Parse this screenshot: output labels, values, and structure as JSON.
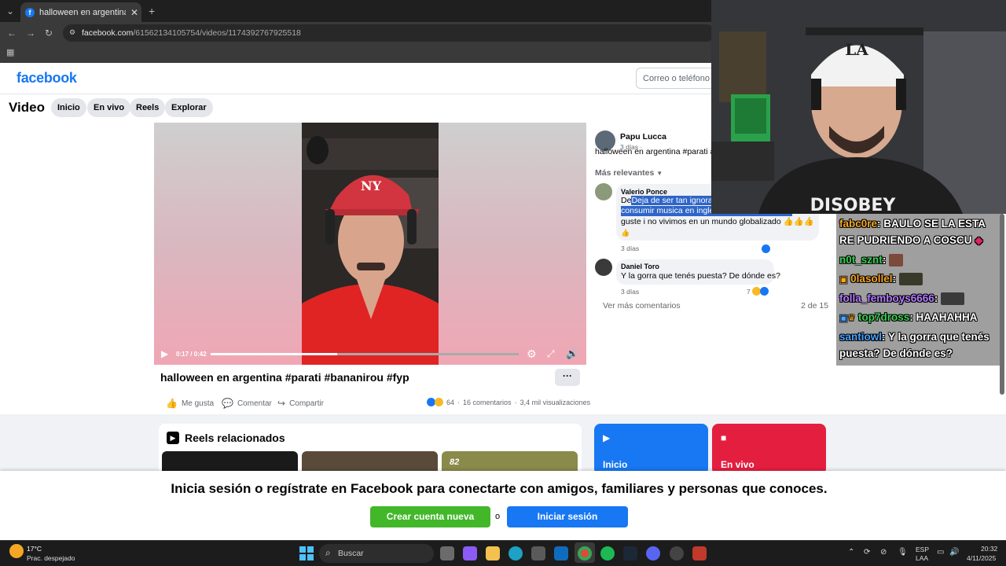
{
  "browser": {
    "tab_title": "halloween en argentina #parati",
    "url_host": "facebook.com",
    "url_path": "/61562134105754/videos/1174392767925518"
  },
  "fb": {
    "logo": "facebook",
    "email_placeholder": "Correo o teléfono",
    "section_title": "Video",
    "nav_pills": [
      "Inicio",
      "En vivo",
      "Reels",
      "Explorar"
    ]
  },
  "video": {
    "time": "0:17 / 0:42",
    "progress_fraction": 0.41,
    "caption": "halloween en argentina #parati #bananirou #fyp",
    "more_label": "···",
    "actions": {
      "like": "Me gusta",
      "comment": "Comentar",
      "share": "Compartir"
    },
    "reaction_count": "64",
    "comments_count": "16 comentarios",
    "views_count": "3,4 mil visualizaciones"
  },
  "post": {
    "author": "Papu Lucca",
    "age": "3 días ·",
    "text": "halloween en argentina #parati #l",
    "sort_label": "Más relevantes"
  },
  "comments": [
    {
      "name": "Valerio Ponce",
      "line1": "Deja de ser tan ignorante",
      "line2": "consumir musica en ingles",
      "line3": "guste i no vivimos en un mundo globalizado 👍👍👍",
      "line4": "👍",
      "time": "3 días"
    },
    {
      "name": "Daniel Toro",
      "line1": "Y la gorra que tenés puesta? De dónde es?",
      "time": "3 días",
      "reactions": "7"
    }
  ],
  "comments_footer": {
    "more": "Ver más comentarios",
    "count": "2 de 15"
  },
  "reels": {
    "title": "Reels relacionados",
    "thumb3_badge": "82"
  },
  "side_cards": {
    "home": "Inicio",
    "live": "En vivo"
  },
  "login_prompt": {
    "message": "Inicia sesión o regístrate en Facebook para conectarte con amigos, familiares y personas que conoces.",
    "create": "Crear cuenta nueva",
    "or": "o",
    "login": "Iniciar sesión"
  },
  "chat": [
    {
      "user": "fabc0re",
      "user_color": "#f5a623",
      "text": ": BAULO SE LA ESTA RE PUDRIENDO A COSCU"
    },
    {
      "user": "n0t_sznt",
      "user_color": "#39d353",
      "text": ":"
    },
    {
      "user": "0lasollel",
      "user_color": "#f5a623",
      "text": ":"
    },
    {
      "user": "folla_femboys6666",
      "user_color": "#b57cff",
      "text": ":"
    },
    {
      "user": "top7dross",
      "user_color": "#39d353",
      "text": ": HAAHAHHA"
    },
    {
      "user": "santiowl",
      "user_color": "#4aa3ff",
      "text": ": Y la gorra que tenés puesta? De dónde es?"
    }
  ],
  "taskbar": {
    "weather_temp": "17°C",
    "weather_desc": "Prac. despejado",
    "search": "Buscar",
    "lang1": "ESP",
    "lang2": "LAA",
    "time": "20:32",
    "date": "4/11/2025"
  }
}
